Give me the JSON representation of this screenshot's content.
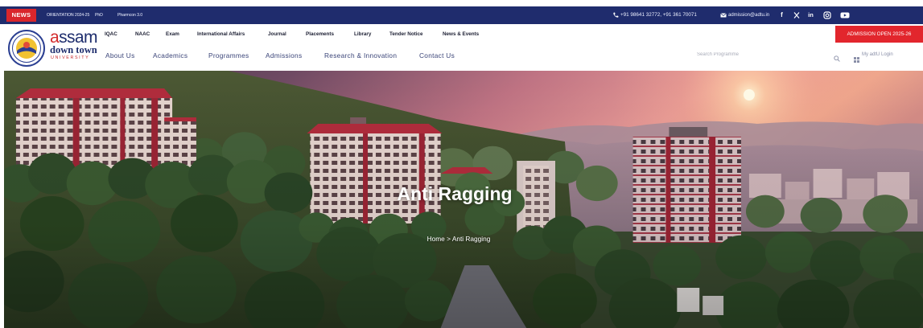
{
  "topbar": {
    "news_label": "NEWS",
    "news_items": [
      "ORIENTATION 2024-25",
      "PhD",
      "Pharmcon 3.0"
    ],
    "phone": "+91 98641 32772, +91 361 70071",
    "email": "admission@adtu.in",
    "icons": [
      "phone-icon",
      "email-icon"
    ],
    "social_icons": [
      "facebook-icon",
      "x-icon",
      "linkedin-icon",
      "instagram-icon",
      "youtube-icon"
    ]
  },
  "header": {
    "logo": {
      "line1": "assam",
      "line2": "down town",
      "line3": "UNIVERSITY"
    },
    "nav_top": [
      "IQAC",
      "NAAC",
      "Exam",
      "International Affairs",
      "Journal",
      "Placements",
      "Library",
      "Tender Notice",
      "News & Events"
    ],
    "nav_main": [
      "About Us",
      "Academics",
      "Programmes",
      "Admissions",
      "Research & Innovation",
      "Contact Us"
    ],
    "admission_button": "ADMISSION OPEN 2025-26",
    "search_placeholder": "Search Programme",
    "search_icon": "search-icon",
    "login_icon": "grid-icon",
    "login_label": "My adtU Login"
  },
  "hero": {
    "title": "Anti Ragging",
    "breadcrumb": {
      "home": "Home",
      "separator": ">",
      "current": "Anti Ragging"
    }
  },
  "theme": {
    "topbar_bg": "#1f2c6d",
    "news_badge_bg": "#d9262c",
    "nav_top_text": "#1c1f33",
    "nav_main_text": "#3a4478",
    "admission_bg": "#e2262d",
    "hero_text": "#ffffff"
  }
}
